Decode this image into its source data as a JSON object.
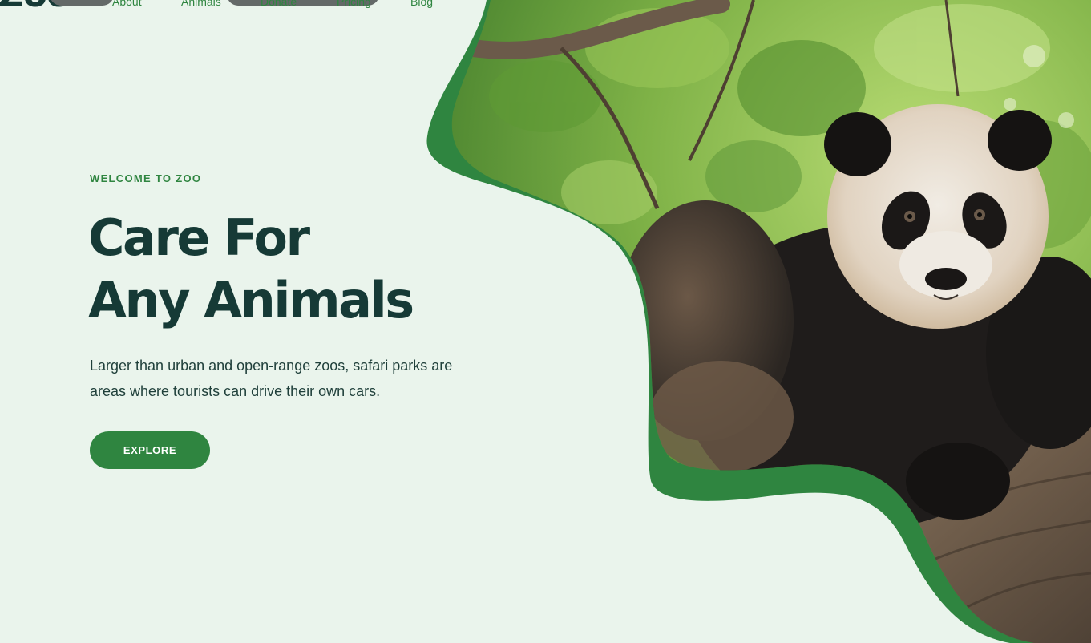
{
  "brand": {
    "logo_text": "Zoo"
  },
  "nav": {
    "links": [
      "About",
      "Animals",
      "Donate",
      "Pricing",
      "Blog"
    ]
  },
  "hero": {
    "eyebrow": "WELCOME TO ZOO",
    "headline_line1": "Care For",
    "headline_line2": "Any Animals",
    "description": "Larger than urban and open-range zoos, safari parks are areas where tourists can drive their own cars.",
    "cta_label": "EXPLORE",
    "image_alt": "Giant panda climbing a tree branch"
  },
  "colors": {
    "background": "#eaf4ec",
    "brand_green": "#2f8540",
    "heading_dark": "#163a36",
    "body_text": "#1f3f3a"
  }
}
